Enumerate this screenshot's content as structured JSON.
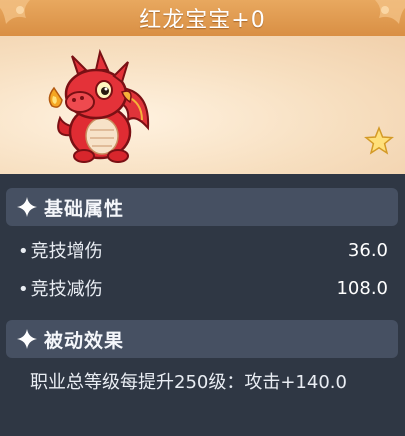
{
  "item": {
    "title": "红龙宝宝+0",
    "icon": "red-dragon-baby",
    "rarity_icon": "star-icon"
  },
  "sections": {
    "base_attributes": {
      "header": "基础属性",
      "stats": [
        {
          "name": "竞技增伤",
          "value": "36.0"
        },
        {
          "name": "竞技减伤",
          "value": "108.0"
        }
      ]
    },
    "passive_effect": {
      "header": "被动效果",
      "text": "职业总等级每提升250级：攻击+140.0"
    }
  },
  "colors": {
    "title_bar": "#d98f44",
    "panel_bg": "#2f3744",
    "section_header_bg": "#465062",
    "showcase_bg": "#f7dfc0"
  }
}
